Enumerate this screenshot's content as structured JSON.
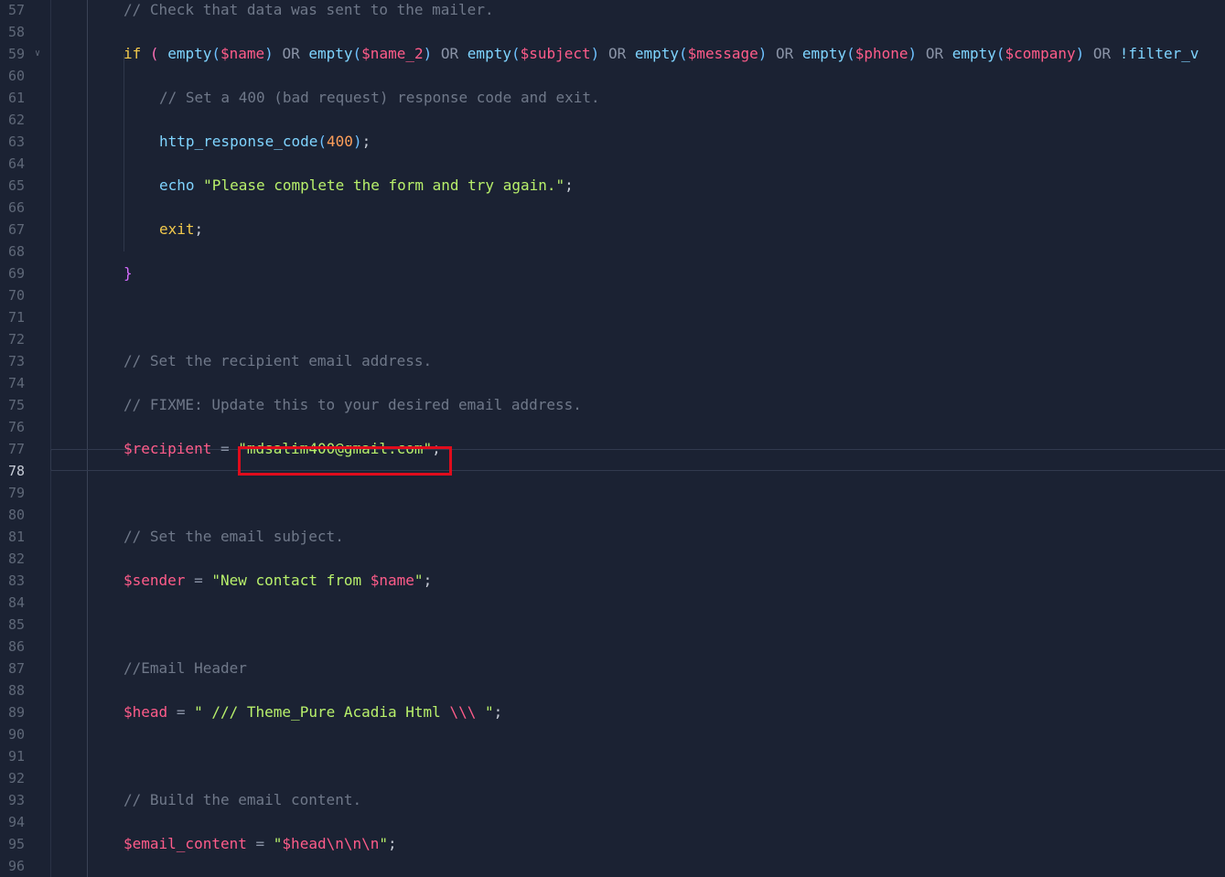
{
  "gutter": {
    "line_numbers": [
      "57",
      "58",
      "59",
      "60",
      "61",
      "62",
      "63",
      "64",
      "65",
      "66",
      "67",
      "68",
      "69",
      "70",
      "71",
      "72",
      "73",
      "74",
      "75",
      "76",
      "77",
      "78",
      "79",
      "80",
      "81",
      "82",
      "83",
      "84",
      "85",
      "86",
      "87",
      "88",
      "89",
      "90",
      "91",
      "92",
      "93",
      "94",
      "95",
      "96"
    ],
    "active_line": "78"
  },
  "code": {
    "l58": {
      "comment": "// Check that data was sent to the mailer."
    },
    "l60": {
      "if": "if",
      "p1": "(",
      "empty": "empty",
      "op_or": "OR",
      "v_name": "$name",
      "v_name2": "$name_2",
      "v_subject": "$subject",
      "v_message": "$message",
      "v_phone": "$phone",
      "v_company": "$company",
      "filter": "!filter_v"
    },
    "l62": {
      "comment": "// Set a 400 (bad request) response code and exit."
    },
    "l64": {
      "fn": "http_response_code",
      "num": "400"
    },
    "l66": {
      "echo": "echo",
      "str": "\"Please complete the form and try again.\""
    },
    "l68": {
      "exit": "exit"
    },
    "l70": {
      "brace": "}"
    },
    "l74": {
      "comment": "// Set the recipient email address."
    },
    "l76": {
      "comment": "// FIXME: Update this to your desired email address."
    },
    "l78": {
      "var": "$recipient",
      "op": "=",
      "str": "\"mdsalim400@gmail.com\""
    },
    "l82": {
      "comment": "// Set the email subject."
    },
    "l84": {
      "var": "$sender",
      "op": "=",
      "str_a": "\"New contact from ",
      "var_in": "$name",
      "str_b": "\""
    },
    "l88": {
      "comment": "//Email Header"
    },
    "l90": {
      "var": "$head",
      "op": "=",
      "str_a": "\" /// Theme_Pure Acadia Html ",
      "esc": "\\\\\\",
      "str_b": " \""
    },
    "l94": {
      "comment": "// Build the email content."
    },
    "l96": {
      "var": "$email_content",
      "op": "=",
      "str_a": "\"",
      "var_in": "$head",
      "esc": "\\n\\n\\n",
      "str_b": "\""
    }
  }
}
